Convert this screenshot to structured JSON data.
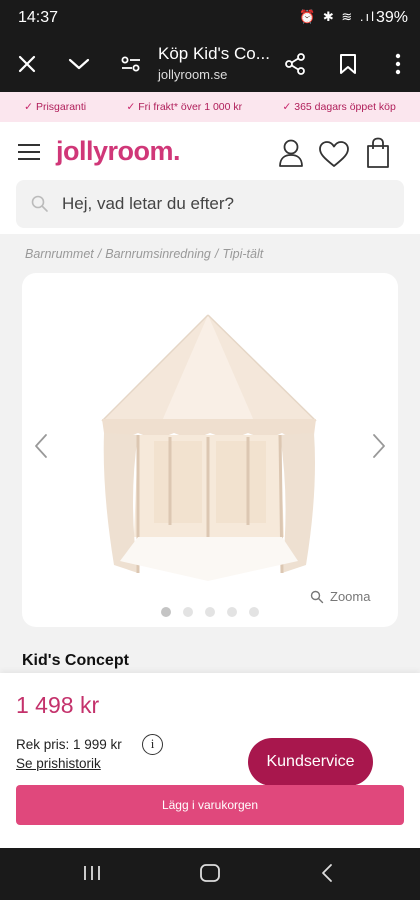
{
  "status_bar": {
    "time": "14:37",
    "icons": "⏰ ✱ ≋ .ıl",
    "battery": "39%"
  },
  "browser": {
    "title": "Köp Kid's Co...",
    "url": "jollyroom.se",
    "icons": [
      "close-icon",
      "chevron-down-icon",
      "site-settings-icon",
      "share-icon",
      "bookmark-icon"
    ]
  },
  "usp": {
    "check": "✓",
    "items": [
      "Prisgaranti",
      "Fri frakt* över 1 000 kr",
      "365 dagars öppet köp"
    ]
  },
  "header": {
    "logo": "jollyroom.",
    "search_placeholder": "Hej, vad letar du efter?",
    "brand_color": "#d03778"
  },
  "breadcrumb": {
    "items": [
      "Barnrummet",
      "Barnrumsinredning",
      "Tipi-tält"
    ],
    "separator": "/"
  },
  "gallery": {
    "zoom_label": "Zooma",
    "image_count": 5,
    "active_index": 0
  },
  "product": {
    "brand": "Kid's Concept",
    "price": "1 498 kr",
    "price_color": "#c4316b",
    "rek_price": "Rek pris: 1 999 kr",
    "price_history": "Se prishistorik",
    "info_glyph": "i",
    "customer_service": "Kundservice",
    "add_to_cart": "Lägg i varukorgen",
    "cart_color": "#e0487c",
    "service_color": "#a8174d"
  },
  "nav_bar": {
    "icons": [
      "recent-apps-icon",
      "home-icon",
      "back-icon"
    ]
  }
}
